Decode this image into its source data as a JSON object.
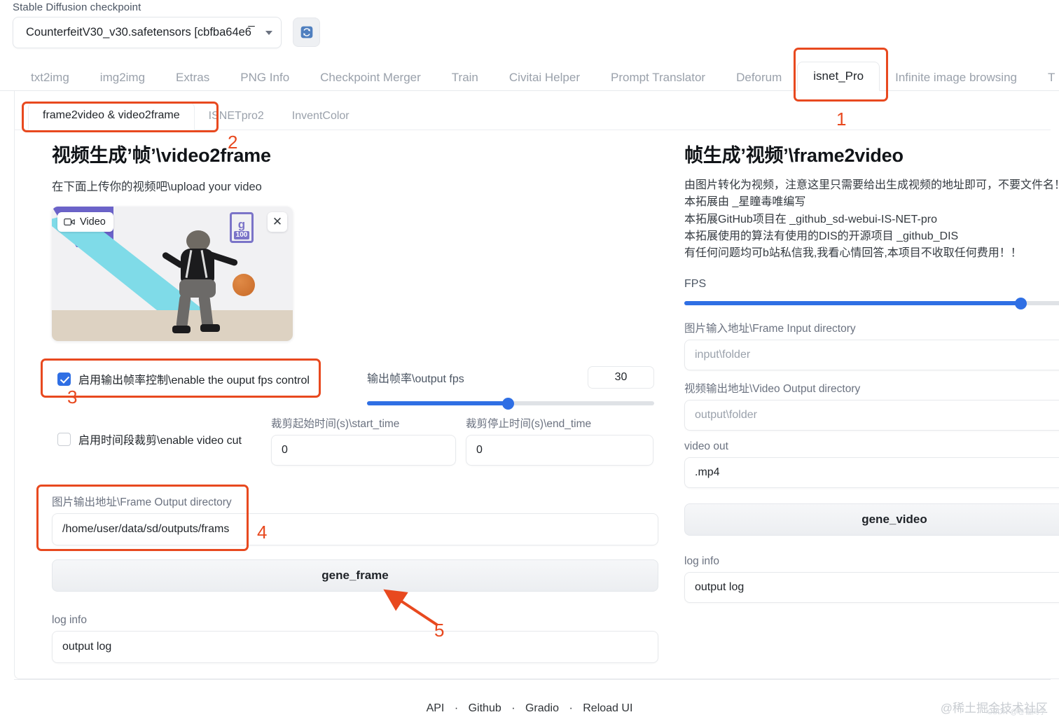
{
  "checkpoint": {
    "label": "Stable Diffusion checkpoint",
    "value": "CounterfeitV30_v30.safetensors [cbfba64e6̅",
    "refresh_icon": "refresh-icon",
    "caret_icon": "chevron-down-icon"
  },
  "top_tabs": [
    {
      "label": "txt2img",
      "active": false
    },
    {
      "label": "img2img",
      "active": false
    },
    {
      "label": "Extras",
      "active": false
    },
    {
      "label": "PNG Info",
      "active": false
    },
    {
      "label": "Checkpoint Merger",
      "active": false
    },
    {
      "label": "Train",
      "active": false
    },
    {
      "label": "Civitai Helper",
      "active": false
    },
    {
      "label": "Prompt Translator",
      "active": false
    },
    {
      "label": "Deforum",
      "active": false
    },
    {
      "label": "isnet_Pro",
      "active": true
    },
    {
      "label": "Infinite image browsing",
      "active": false
    },
    {
      "label": "T",
      "active": false
    }
  ],
  "sub_tabs": [
    {
      "label": "frame2video & video2frame",
      "active": true
    },
    {
      "label": "ISNETpro2",
      "active": false
    },
    {
      "label": "InventColor",
      "active": false
    }
  ],
  "left": {
    "title": "视频生成’帧’\\video2frame",
    "subtitle": "在下面上传你的视频吧\\upload your video",
    "video": {
      "pill_label": "Video",
      "pill_icon": "video-camera-icon",
      "close_icon": "close-icon",
      "watermark_letter": "g",
      "watermark_number": "100"
    },
    "fps_checkbox": {
      "label": "启用输出帧率控制\\enable the ouput fps control",
      "checked": true
    },
    "output_fps": {
      "label": "输出帧率\\output fps",
      "value": "30",
      "percent": 49
    },
    "cut_checkbox": {
      "label": "启用时间段裁剪\\enable video cut",
      "checked": false
    },
    "start_time": {
      "label": "裁剪起始时间(s)\\start_time",
      "value": "0"
    },
    "end_time": {
      "label": "裁剪停止时间(s)\\end_time",
      "value": "0"
    },
    "frame_output_dir": {
      "label": "图片输出地址\\Frame Output directory",
      "value": "/home/user/data/sd/outputs/frams"
    },
    "gene_frame_button": "gene_frame",
    "log": {
      "label": "log info",
      "value": "output log"
    }
  },
  "right": {
    "title": "帧生成’视频’\\frame2video",
    "description": [
      "由图片转化为视频，注意这里只需要给出生成视频的地址即可，不要文件名！",
      "本拓展由 _星瞳毒唯编写",
      "本拓展GitHub项目在 _github_sd-webui-IS-NET-pro",
      "本拓展使用的算法有使用的DIS的开源项目 _github_DIS",
      "有任何问题均可b站私信我,我看心情回答,本项目不收取任何费用！！"
    ],
    "fps": {
      "label": "FPS",
      "percent": 80
    },
    "frame_input_dir": {
      "label": "图片输入地址\\Frame Input directory",
      "placeholder": "input\\folder"
    },
    "video_output_dir": {
      "label": "视频输出地址\\Video Output directory",
      "placeholder": "output\\folder"
    },
    "video_out": {
      "label": "video out",
      "value": ".mp4"
    },
    "gene_video_button": "gene_video",
    "log": {
      "label": "log info",
      "value": "output log"
    }
  },
  "annotations": {
    "color": "#e8491f",
    "numbers": [
      "1",
      "2",
      "3",
      "4",
      "5"
    ]
  },
  "footer": {
    "links": [
      "API",
      "Github",
      "Gradio",
      "Reload UI"
    ],
    "separator": "·"
  },
  "watermarks": {
    "main": "@稀土掘金技术社区",
    "small": "CSDN @卷福同学"
  }
}
